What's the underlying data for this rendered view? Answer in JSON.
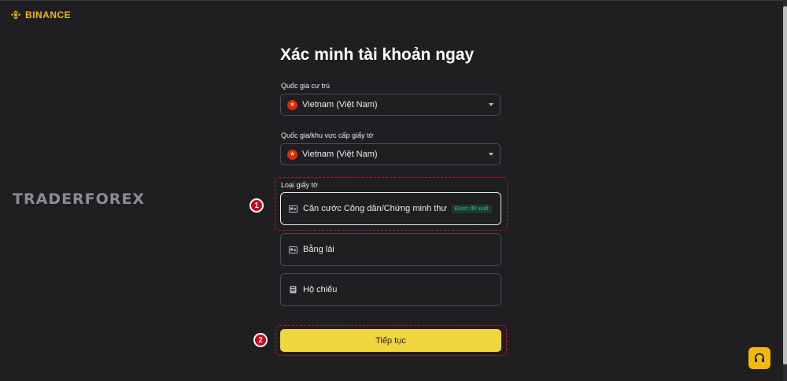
{
  "header": {
    "brand": "BINANCE"
  },
  "watermark": {
    "text": "TRADERFOREX"
  },
  "page": {
    "title": "Xác minh tài khoản ngay"
  },
  "residence": {
    "label": "Quốc gia cư trú",
    "value": "Vietnam (Việt Nam)",
    "flag_icon": "vietnam-flag-icon"
  },
  "issuing": {
    "label": "Quốc gia/khu vực cấp giấy tờ",
    "value": "Vietnam (Việt Nam)",
    "flag_icon": "vietnam-flag-icon"
  },
  "document_type": {
    "label": "Loại giấy tờ",
    "options": [
      {
        "label": "Căn cước Công dân/Chứng minh thư",
        "badge": "Được đề xuất",
        "icon": "id-card-icon",
        "selected": true
      },
      {
        "label": "Bằng lái",
        "icon": "id-card-icon",
        "selected": false
      },
      {
        "label": "Hộ chiếu",
        "icon": "passport-icon",
        "selected": false
      }
    ]
  },
  "actions": {
    "continue_label": "Tiếp tục"
  },
  "annotations": {
    "marker_1": "1",
    "marker_2": "2"
  },
  "colors": {
    "brand": "#f0b90b",
    "button": "#f0d440",
    "background": "#1f1f22",
    "badge_text": "#2ebd85",
    "annotation": "#d0021b"
  }
}
